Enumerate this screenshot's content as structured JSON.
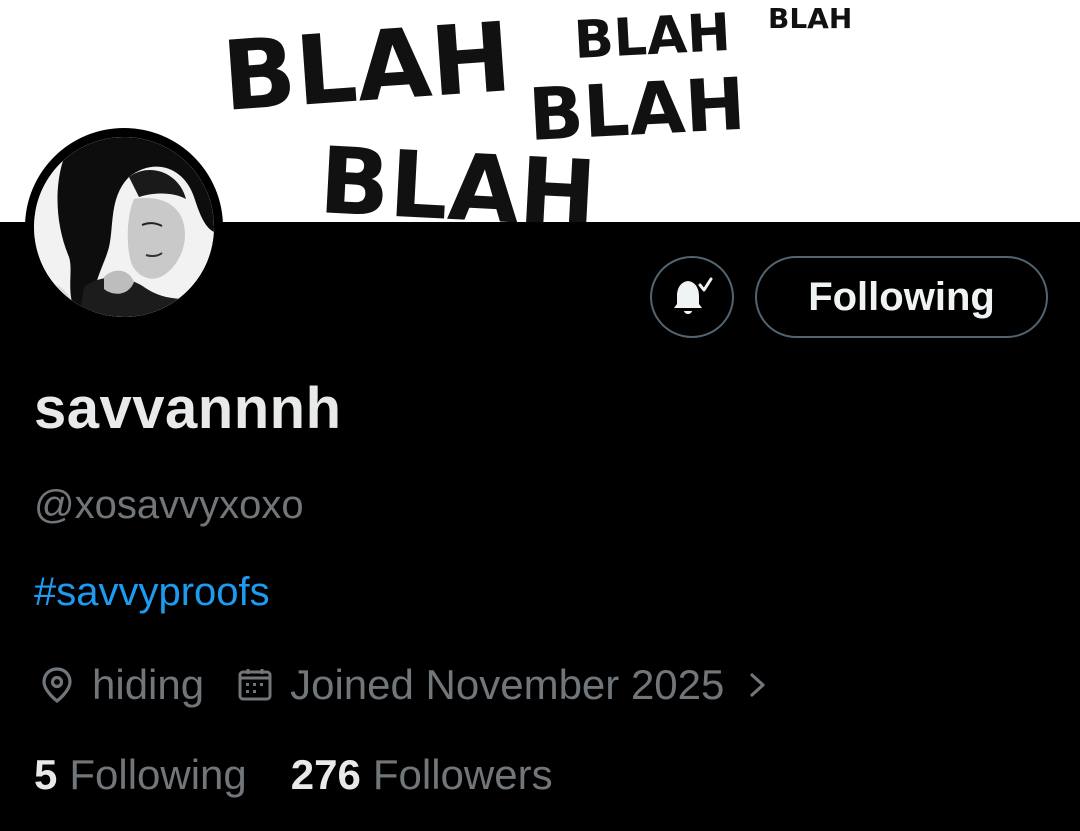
{
  "banner": {
    "words": [
      "BLAH",
      "BLAH",
      "BLAH",
      "BLAH",
      "BLAH"
    ]
  },
  "actions": {
    "notify_icon": "bell-with-check-icon",
    "follow_label": "Following"
  },
  "profile": {
    "display_name": "savvannnh",
    "handle": "@xosavvyxoxo",
    "bio_hashtag": "#savvyproofs",
    "location": "hiding",
    "location_icon": "location-pin-icon",
    "joined": "Joined November 2025",
    "joined_icon": "calendar-icon"
  },
  "stats": {
    "following_count": "5",
    "following_label": "Following",
    "followers_count": "276",
    "followers_label": "Followers"
  },
  "colors": {
    "background": "#000000",
    "text_primary": "#e7e9ea",
    "text_secondary": "#71767b",
    "link": "#1d9bf0",
    "border": "#536471"
  }
}
